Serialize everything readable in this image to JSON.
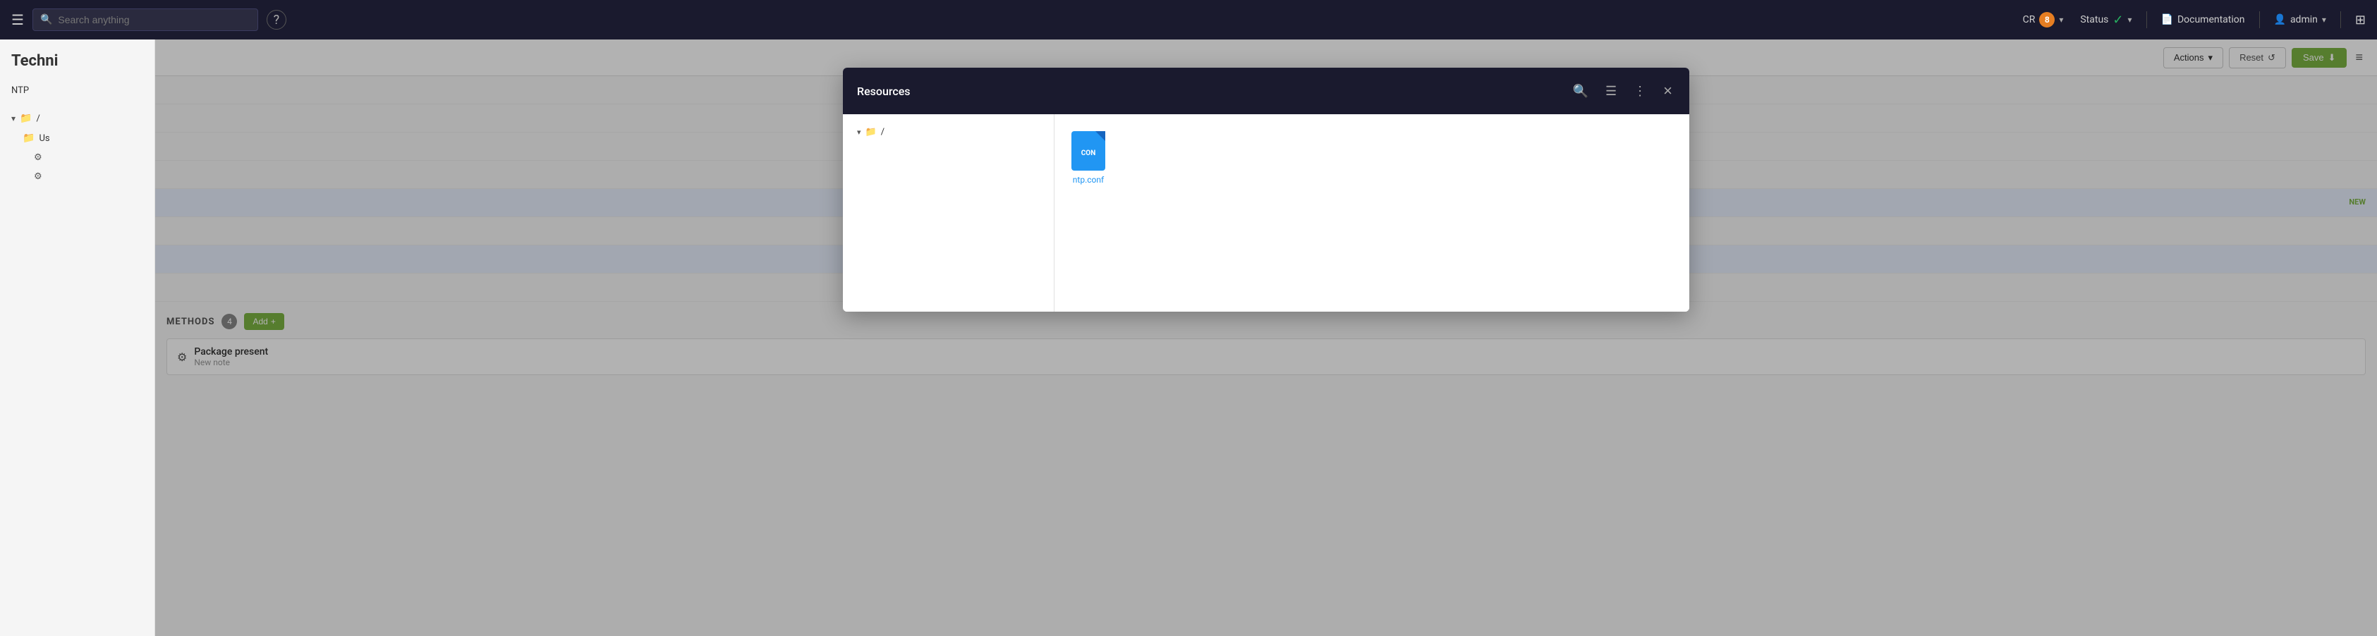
{
  "navbar": {
    "hamburger_label": "☰",
    "search_placeholder": "Search anything",
    "help_label": "?",
    "cr_label": "CR",
    "cr_count": "8",
    "status_label": "Status",
    "status_check": "✓",
    "documentation_label": "Documentation",
    "admin_label": "admin",
    "grid_icon": "⊞"
  },
  "sidebar": {
    "title": "Techni",
    "items": [
      {
        "label": "/",
        "type": "folder",
        "indent": 0
      },
      {
        "label": "Us",
        "type": "folder",
        "indent": 1
      }
    ],
    "gear_items": [
      "gear1",
      "gear2"
    ],
    "ntp_label": "NTP"
  },
  "toolbar": {
    "actions_label": "Actions",
    "reset_label": "Reset",
    "save_label": "Save",
    "menu_icon": "≡"
  },
  "methods": {
    "title": "METHODS",
    "count": "4",
    "add_label": "Add",
    "plus_icon": "+",
    "items": [
      {
        "name": "Package present",
        "subtitle": "New note",
        "badge": ""
      }
    ]
  },
  "content": {
    "new_badge": "NEW"
  },
  "modal": {
    "title": "Resources",
    "search_icon": "🔍",
    "list_icon": "☰",
    "dots_icon": "⋮",
    "close_icon": "×",
    "sidebar": {
      "items": [
        {
          "label": "/",
          "type": "folder",
          "chevron": "▾"
        }
      ]
    },
    "file": {
      "icon_label": "CON",
      "name": "ntp.conf"
    }
  }
}
